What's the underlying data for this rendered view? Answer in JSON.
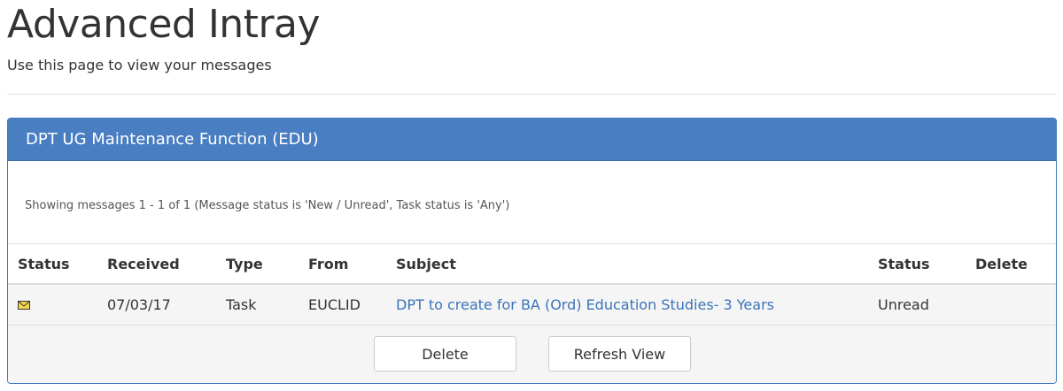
{
  "page": {
    "title": "Advanced Intray",
    "subtitle": "Use this page to view your messages"
  },
  "panel": {
    "heading": "DPT UG Maintenance Function (EDU)",
    "info": "Showing messages 1 - 1 of 1 (Message status is 'New / Unread', Task status is 'Any')"
  },
  "table": {
    "headers": {
      "status": "Status",
      "received": "Received",
      "type": "Type",
      "from": "From",
      "subject": "Subject",
      "msg_status": "Status",
      "delete": "Delete"
    },
    "rows": [
      {
        "status_icon": "envelope-icon",
        "received": "07/03/17",
        "type": "Task",
        "from": "EUCLID",
        "subject": "DPT to create for BA (Ord) Education Studies- 3 Years",
        "msg_status": "Unread"
      }
    ]
  },
  "buttons": {
    "delete_label": "Delete",
    "refresh_label": "Refresh View"
  },
  "colors": {
    "panel_heading_bg": "#4a7ec2",
    "link": "#3a74b8"
  }
}
